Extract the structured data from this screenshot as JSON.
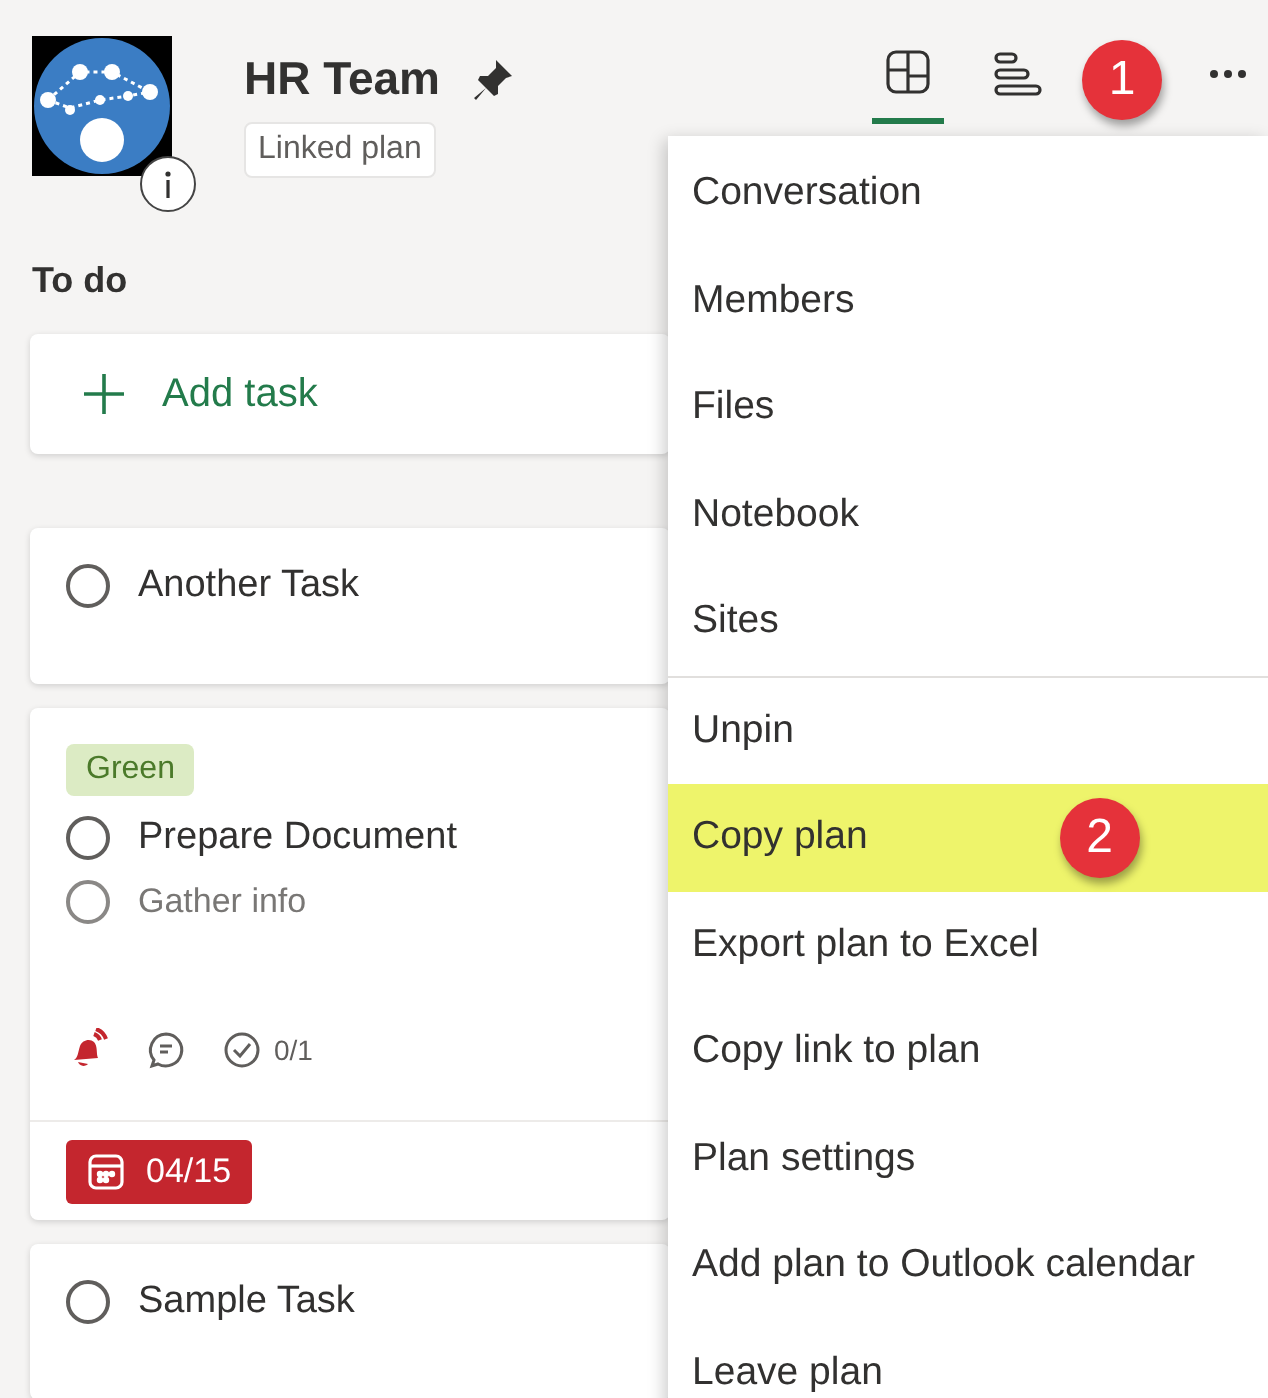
{
  "plan": {
    "title": "HR Team",
    "pinned": true,
    "tag": "Linked plan"
  },
  "views": [
    {
      "kind": "board",
      "selected": true
    },
    {
      "kind": "schedule",
      "selected": false
    }
  ],
  "header_callout": "1",
  "bucket": {
    "title": "To do",
    "add_label": "Add task",
    "tasks": [
      {
        "title": "Another Task",
        "completed": false
      },
      {
        "title": "Prepare Document",
        "completed": false,
        "label": {
          "text": "Green",
          "color": "#dcebc4"
        },
        "checklist": [
          {
            "text": "Gather info",
            "checked": false
          }
        ],
        "alert": true,
        "has_comments": true,
        "checklist_count": "0/1",
        "due": "04/15",
        "overdue": true
      },
      {
        "title": "Sample Task",
        "completed": false
      }
    ]
  },
  "menu": {
    "groups": [
      [
        {
          "label": "Conversation",
          "highlighted": false
        },
        {
          "label": "Members",
          "highlighted": false
        },
        {
          "label": "Files",
          "highlighted": false
        },
        {
          "label": "Notebook",
          "highlighted": false
        },
        {
          "label": "Sites",
          "highlighted": false
        }
      ],
      [
        {
          "label": "Unpin",
          "highlighted": false
        },
        {
          "label": "Copy plan",
          "highlighted": true,
          "callout": "2"
        },
        {
          "label": "Export plan to Excel",
          "highlighted": false
        },
        {
          "label": "Copy link to plan",
          "highlighted": false
        },
        {
          "label": "Plan settings",
          "highlighted": false
        },
        {
          "label": "Add plan to Outlook calendar",
          "highlighted": false
        },
        {
          "label": "Leave plan",
          "highlighted": false
        }
      ]
    ]
  }
}
